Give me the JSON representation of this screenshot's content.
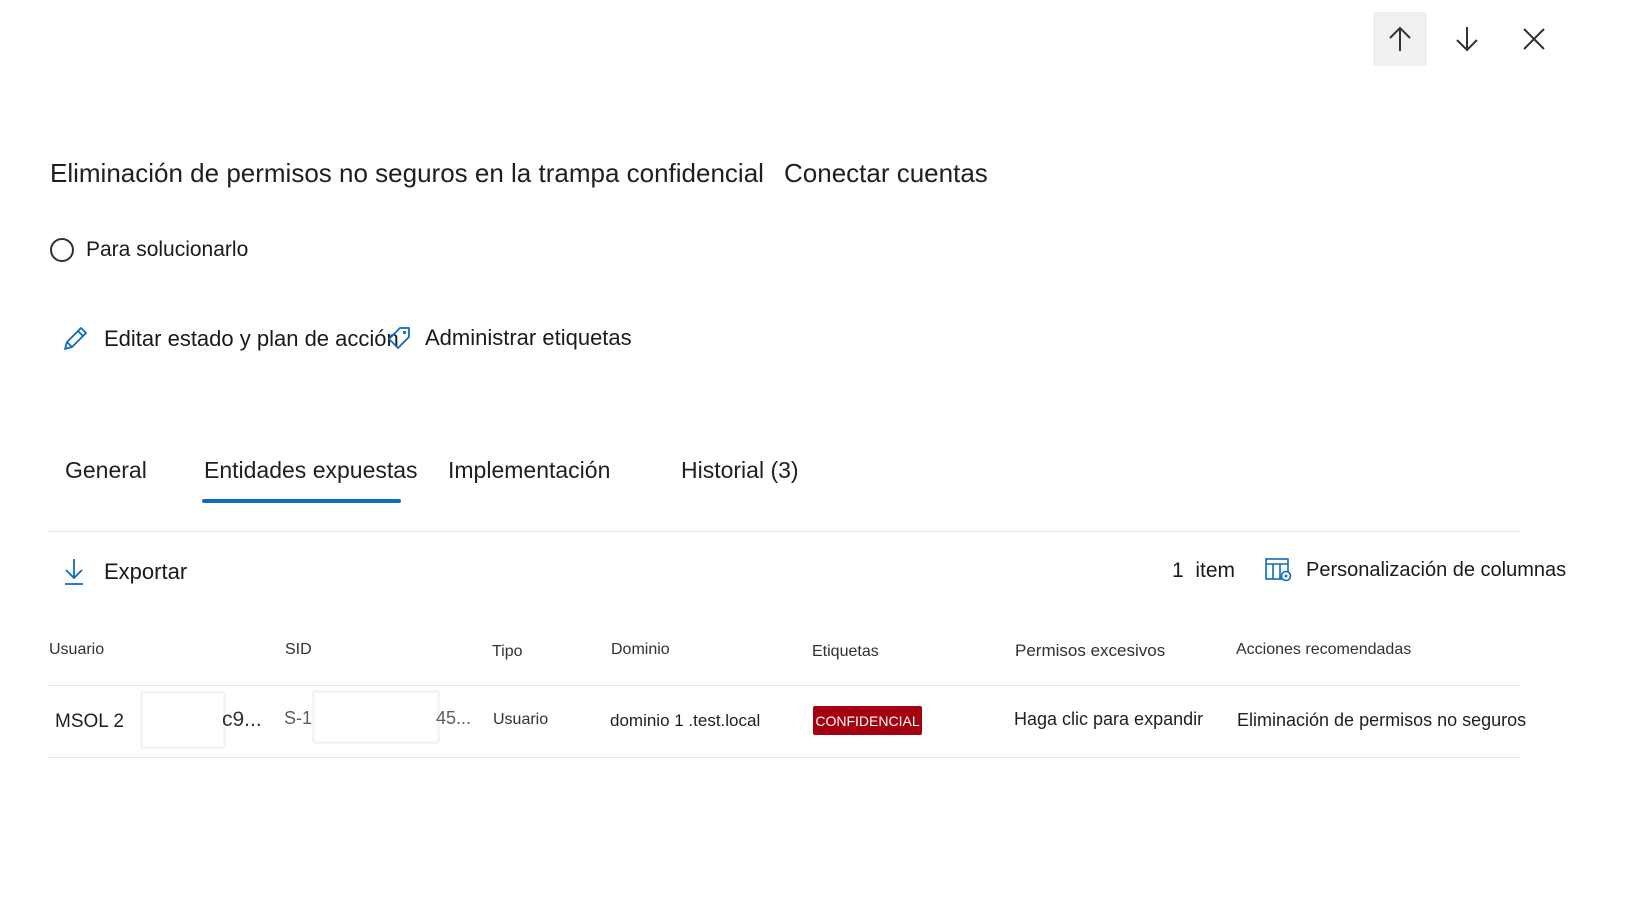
{
  "header": {
    "title": "Eliminación de permisos no seguros en la trampa confidencial",
    "secondary_title": "Conectar cuentas"
  },
  "status": {
    "label": "Para solucionarlo"
  },
  "actions": {
    "edit_label": "Editar estado y plan de acción",
    "manage_tags_label": "Administrar etiquetas"
  },
  "tabs": [
    {
      "label": "General"
    },
    {
      "label": "Entidades expuestas",
      "selected": true
    },
    {
      "label": "Implementación"
    },
    {
      "label": "Historial (3)"
    }
  ],
  "toolbar": {
    "export_label": "Exportar",
    "item_count": "1  item",
    "customize_columns_label": "Personalización de columnas"
  },
  "table": {
    "columns": [
      "Usuario",
      "SID",
      "Tipo",
      "Dominio",
      "Etiquetas",
      "Permisos excesivos",
      "Acciones recomendadas"
    ],
    "rows": [
      {
        "usuario_prefix": "MSOL 2",
        "usuario_suffix": "c9...",
        "sid_prefix": "S-1",
        "sid_suffix": "45...",
        "tipo": "Usuario",
        "dominio": "dominio 1 .test.local",
        "etiqueta": "CONFIDENCIAL",
        "permisos": "Haga clic para expandir",
        "acciones": "Eliminación de permisos no seguros"
      }
    ]
  },
  "colors": {
    "accent": "#0f6cbd",
    "badge": "#a4000f"
  }
}
